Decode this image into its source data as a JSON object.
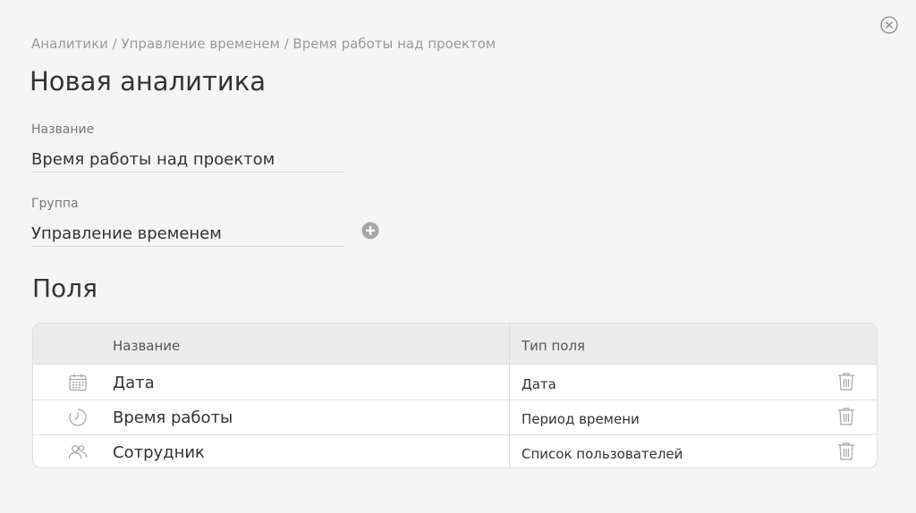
{
  "breadcrumb": "Аналитики / Управление временем / Время работы над проектом",
  "page_title": "Новая аналитика",
  "form": {
    "name_label": "Название",
    "name_value": "Время работы над проектом",
    "group_label": "Группа",
    "group_value": "Управление временем"
  },
  "fields_section": {
    "title": "Поля",
    "columns": [
      "Название",
      "Тип поля"
    ],
    "rows": [
      {
        "icon": "calendar-icon",
        "name": "Дата",
        "type": "Дата"
      },
      {
        "icon": "clock-icon",
        "name": "Время работы",
        "type": "Период времени"
      },
      {
        "icon": "users-icon",
        "name": "Сотрудник",
        "type": "Список пользователей"
      }
    ]
  },
  "colors": {
    "background": "#f5f5f5",
    "header_bg": "#ebebeb",
    "icon_gray": "#a6a6a6",
    "muted_text": "#999999"
  }
}
